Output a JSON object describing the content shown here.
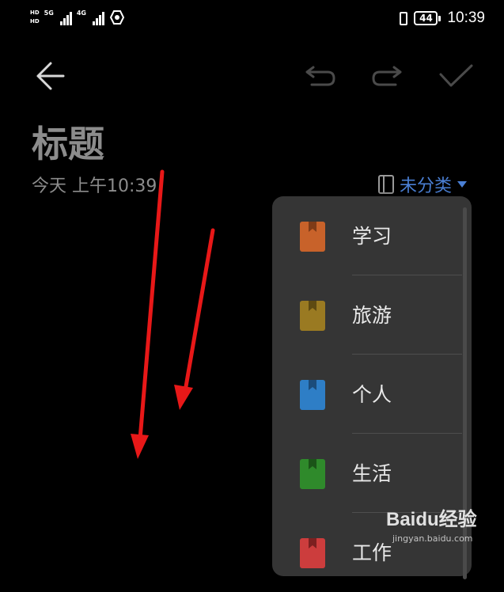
{
  "statusbar": {
    "hd1": "HD",
    "hd2": "HD",
    "net1": "5G",
    "net2": "4G",
    "battery": "44",
    "time": "10:39"
  },
  "toolbar": {
    "back_icon": "arrow-left-icon",
    "undo_icon": "undo-icon",
    "redo_icon": "redo-icon",
    "done_icon": "check-icon"
  },
  "note": {
    "title": "标题",
    "date": "今天 上午10:39",
    "category": "未分类"
  },
  "menu": {
    "items": [
      {
        "label": "学习",
        "color": "#c8622a"
      },
      {
        "label": "旅游",
        "color": "#9a7a22"
      },
      {
        "label": "个人",
        "color": "#2e7ec6"
      },
      {
        "label": "生活",
        "color": "#2f8a2b"
      },
      {
        "label": "工作",
        "color": "#cc3d3d"
      }
    ]
  },
  "watermark": {
    "main": "Baidu经验",
    "sub": "jingyan.baidu.com"
  },
  "colors": {
    "accent": "#4a7fd4",
    "arrow": "#e81818"
  }
}
